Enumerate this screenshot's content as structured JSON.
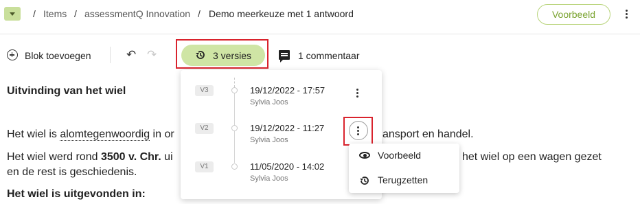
{
  "breadcrumb": {
    "items": [
      "Items",
      "assessmentQ Innovation",
      "Demo meerkeuze met 1 antwoord"
    ],
    "separator": "/"
  },
  "header": {
    "preview_button": "Voorbeeld",
    "more_icon": "more-vertical-icon",
    "folder_icon": "folder-icon"
  },
  "toolbar": {
    "add_block": "Blok toevoegen",
    "undo_icon": "undo-icon",
    "redo_icon": "redo-icon",
    "versions": "3 versies",
    "comments": "1 commentaar"
  },
  "document": {
    "title": "Uitvinding van het wiel",
    "p1_start": "Het wiel is ",
    "p1_underlined": "alomtegenwoordig",
    "p1_mid": " in ",
    "p1_frag": "or",
    "p1_end": "ansport en handel.",
    "p2_start": "Het wiel werd rond ",
    "p2_bold": "3500 v. Chr.",
    "p2_mid": " ui",
    "p2_end": "het wiel op een wagen gezet",
    "p3": "en de rest is geschiedenis.",
    "question": "Het wiel is uitgevonden in:"
  },
  "versions_panel": {
    "items": [
      {
        "badge": "V3",
        "date": "19/12/2022 - 17:57",
        "author": "Sylvia Joos"
      },
      {
        "badge": "V2",
        "date": "19/12/2022 - 11:27",
        "author": "Sylvia Joos"
      },
      {
        "badge": "V1",
        "date": "11/05/2020 - 14:02",
        "author": "Sylvia Joos"
      }
    ]
  },
  "context_menu": {
    "items": [
      {
        "label": "Voorbeeld",
        "icon": "eye-icon"
      },
      {
        "label": "Terugzetten",
        "icon": "restore-icon"
      }
    ]
  },
  "colors": {
    "accent_green": "#cfe5a5",
    "preview_text": "#7aa32f",
    "highlight_red": "#d9232d"
  }
}
